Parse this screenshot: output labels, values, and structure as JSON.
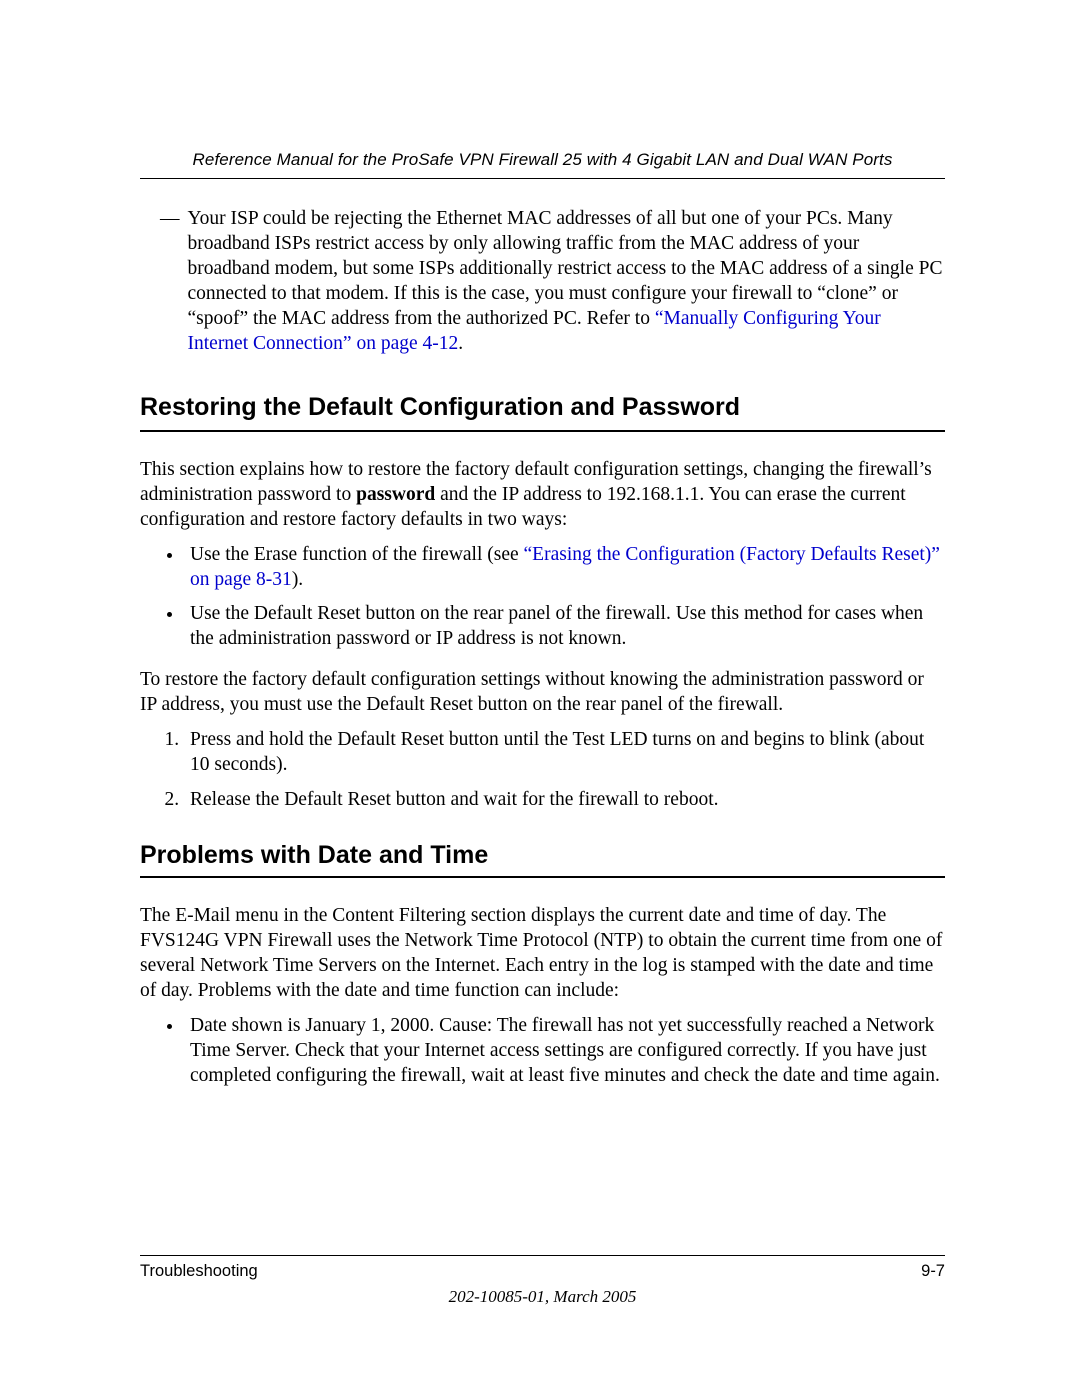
{
  "header": {
    "title": "Reference Manual for the ProSafe VPN Firewall 25 with 4 Gigabit LAN and Dual WAN Ports"
  },
  "intro_dash": {
    "prefix": "— ",
    "text_a": "Your ISP could be rejecting the Ethernet MAC addresses of all but one of your PCs. Many broadband ISPs restrict access by only allowing traffic from the MAC address of your broadband modem, but some ISPs additionally restrict access to the MAC address of a single PC connected to that modem. If this is the case, you must configure your firewall to “clone” or “spoof” the MAC address from the authorized PC. Refer to ",
    "link": "“Manually Configuring Your Internet Connection” on page 4-12",
    "period": "."
  },
  "section1": {
    "heading": "Restoring the Default Configuration and Password",
    "para_a": "This section explains how to restore the factory default configuration settings, changing the firewall’s administration password to ",
    "para_bold": "password",
    "para_b": " and the IP address to 192.168.1.1. You can erase the current configuration and restore factory defaults in two ways:",
    "bullets": {
      "b1_a": "Use the Erase function of the firewall (see ",
      "b1_link": "“Erasing the Configuration (Factory Defaults Reset)” on page 8-31",
      "b1_b": ").",
      "b2": "Use the Default Reset button on the rear panel of the firewall. Use this method for cases when the administration password or IP address is not known."
    },
    "para2": "To restore the factory default configuration settings without knowing the administration password or IP address, you must use the Default Reset button on the rear panel of the firewall.",
    "steps": {
      "s1": "Press and hold the Default Reset button until the Test LED turns on and begins to blink (about 10 seconds).",
      "s2": "Release the Default Reset button and wait for the firewall to reboot."
    }
  },
  "section2": {
    "heading": "Problems with Date and Time",
    "para": "The E-Mail menu in the Content Filtering section displays the current date and time of day. The FVS124G VPN Firewall uses the Network Time Protocol (NTP) to obtain the current time from one of several Network Time Servers on the Internet. Each entry in the log is stamped with the date and time of day. Problems with the date and time function can include:",
    "bullets": {
      "b1": "Date shown is January 1, 2000. Cause: The firewall has not yet successfully reached a Network Time Server. Check that your Internet access settings are configured correctly. If you have just completed configuring the firewall, wait at least five minutes and check the date and time again."
    }
  },
  "footer": {
    "left": "Troubleshooting",
    "right": "9-7",
    "sub": "202-10085-01, March 2005"
  }
}
